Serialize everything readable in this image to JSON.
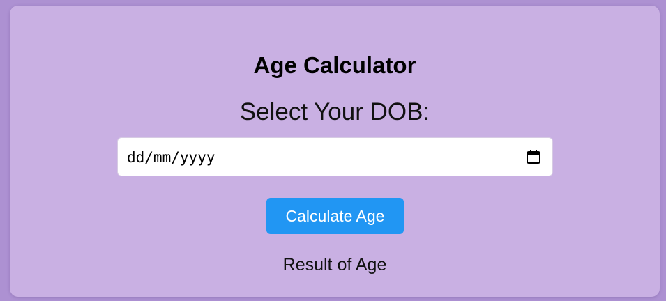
{
  "app": {
    "title": "Age Calculator",
    "dob_label": "Select Your DOB:",
    "date_input": {
      "placeholder": "dd/mm/yyyy",
      "value": ""
    },
    "calculate_button_label": "Calculate Age",
    "result_text": "Result of Age"
  },
  "colors": {
    "page_background": "#ad91d2",
    "card_background": "#c9b0e3",
    "button_background": "#2196f3",
    "button_text": "#ffffff"
  },
  "icons": {
    "date_picker": "calendar-icon"
  }
}
